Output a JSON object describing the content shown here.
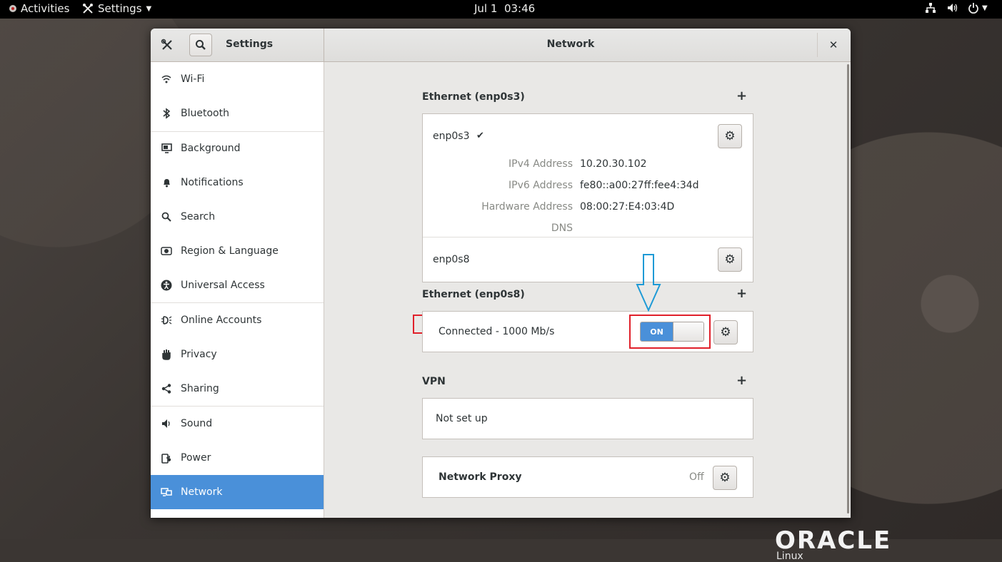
{
  "topbar": {
    "activities": "Activities",
    "app_menu": "Settings",
    "clock": "Jul 1  03:46"
  },
  "window": {
    "left_title": "Settings",
    "title": "Network"
  },
  "sidebar": {
    "items": [
      {
        "label": "Wi-Fi",
        "icon": "wifi-icon"
      },
      {
        "label": "Bluetooth",
        "icon": "bluetooth-icon"
      },
      {
        "label": "Background",
        "icon": "background-icon"
      },
      {
        "label": "Notifications",
        "icon": "bell-icon"
      },
      {
        "label": "Search",
        "icon": "search-icon"
      },
      {
        "label": "Region & Language",
        "icon": "region-icon"
      },
      {
        "label": "Universal Access",
        "icon": "accessibility-icon"
      },
      {
        "label": "Online Accounts",
        "icon": "online-accounts-icon"
      },
      {
        "label": "Privacy",
        "icon": "hand-icon"
      },
      {
        "label": "Sharing",
        "icon": "share-icon"
      },
      {
        "label": "Sound",
        "icon": "speaker-icon"
      },
      {
        "label": "Power",
        "icon": "power-plug-icon"
      },
      {
        "label": "Network",
        "icon": "network-icon",
        "selected": true
      }
    ]
  },
  "ethernet1": {
    "title": "Ethernet (enp0s3)",
    "device1": {
      "name": "enp0s3",
      "checkmark": "✔",
      "ipv4_label": "IPv4 Address",
      "ipv4": "10.20.30.102",
      "ipv6_label": "IPv6 Address",
      "ipv6": "fe80::a00:27ff:fee4:34d",
      "hw_label": "Hardware Address",
      "hw": "08:00:27:E4:03:4D",
      "dns_label": "DNS"
    },
    "device2": {
      "name": "enp0s8"
    }
  },
  "ethernet2": {
    "title": "Ethernet (enp0s8)",
    "status": "Connected - 1000 Mb/s",
    "switch_label": "ON"
  },
  "vpn": {
    "title": "VPN",
    "status": "Not set up"
  },
  "proxy": {
    "title": "Network Proxy",
    "status": "Off"
  },
  "branding": {
    "logo": "ORACLE",
    "sub": "Linux"
  },
  "colors": {
    "accent": "#4a90d9",
    "highlight": "#e0202a",
    "arrow": "#1e9ad6"
  }
}
